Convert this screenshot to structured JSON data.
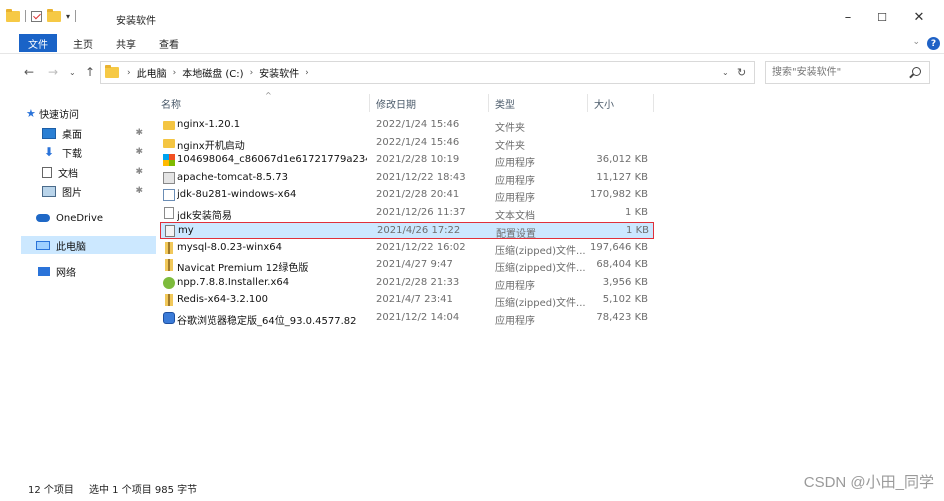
{
  "window": {
    "title": "安装软件",
    "controls": {
      "minimize": "–",
      "maximize": "☐",
      "close": "✕"
    }
  },
  "ribbon": {
    "tabs": [
      "文件",
      "主页",
      "共享",
      "查看"
    ],
    "help": "?",
    "collapse": "⌄"
  },
  "nav": {
    "back": "←",
    "forward": "→",
    "up": "↑",
    "recent": "⌄",
    "breadcrumb": [
      "此电脑",
      "本地磁盘 (C:)",
      "安装软件"
    ],
    "search_placeholder": "搜索\"安装软件\""
  },
  "sidebar": {
    "quick_access": "快速访问",
    "items": [
      {
        "label": "桌面",
        "icon": "desktop-icon",
        "pinned": true
      },
      {
        "label": "下载",
        "icon": "download-icon",
        "pinned": true
      },
      {
        "label": "文档",
        "icon": "document-icon",
        "pinned": true
      },
      {
        "label": "图片",
        "icon": "picture-icon",
        "pinned": true
      }
    ],
    "onedrive": "OneDrive",
    "this_pc": "此电脑",
    "network": "网络"
  },
  "columns": {
    "name": "名称",
    "date": "修改日期",
    "type": "类型",
    "size": "大小"
  },
  "files": [
    {
      "name": "nginx-1.20.1",
      "date": "2022/1/24 15:46",
      "type": "文件夹",
      "size": "",
      "icon": "folder"
    },
    {
      "name": "nginx开机启动",
      "date": "2022/1/24 15:46",
      "type": "文件夹",
      "size": "",
      "icon": "folder"
    },
    {
      "name": "104698064_c86067d1e61721779a234...",
      "date": "2021/2/28 10:19",
      "type": "应用程序",
      "size": "36,012 KB",
      "icon": "app"
    },
    {
      "name": "apache-tomcat-8.5.73",
      "date": "2021/12/22 18:43",
      "type": "应用程序",
      "size": "11,127 KB",
      "icon": "tomcat"
    },
    {
      "name": "jdk-8u281-windows-x64",
      "date": "2021/2/28 20:41",
      "type": "应用程序",
      "size": "170,982 KB",
      "icon": "java"
    },
    {
      "name": "jdk安装简易",
      "date": "2021/12/26 11:37",
      "type": "文本文档",
      "size": "1 KB",
      "icon": "text"
    },
    {
      "name": "my",
      "date": "2021/4/26 17:22",
      "type": "配置设置",
      "size": "1 KB",
      "icon": "ini",
      "selected": true
    },
    {
      "name": "mysql-8.0.23-winx64",
      "date": "2021/12/22 16:02",
      "type": "压缩(zipped)文件...",
      "size": "197,646 KB",
      "icon": "zip"
    },
    {
      "name": "Navicat Premium 12绿色版",
      "date": "2021/4/27 9:47",
      "type": "压缩(zipped)文件...",
      "size": "68,404 KB",
      "icon": "zip"
    },
    {
      "name": "npp.7.8.8.Installer.x64",
      "date": "2021/2/28 21:33",
      "type": "应用程序",
      "size": "3,956 KB",
      "icon": "npp"
    },
    {
      "name": "Redis-x64-3.2.100",
      "date": "2021/4/7 23:41",
      "type": "压缩(zipped)文件...",
      "size": "5,102 KB",
      "icon": "zip"
    },
    {
      "name": "谷歌浏览器稳定版_64位_93.0.4577.82",
      "date": "2021/12/2 14:04",
      "type": "应用程序",
      "size": "78,423 KB",
      "icon": "chrome"
    }
  ],
  "status": {
    "count": "12 个项目",
    "selection": "选中 1 个项目  985 字节"
  },
  "watermark": "CSDN @小田_同学"
}
